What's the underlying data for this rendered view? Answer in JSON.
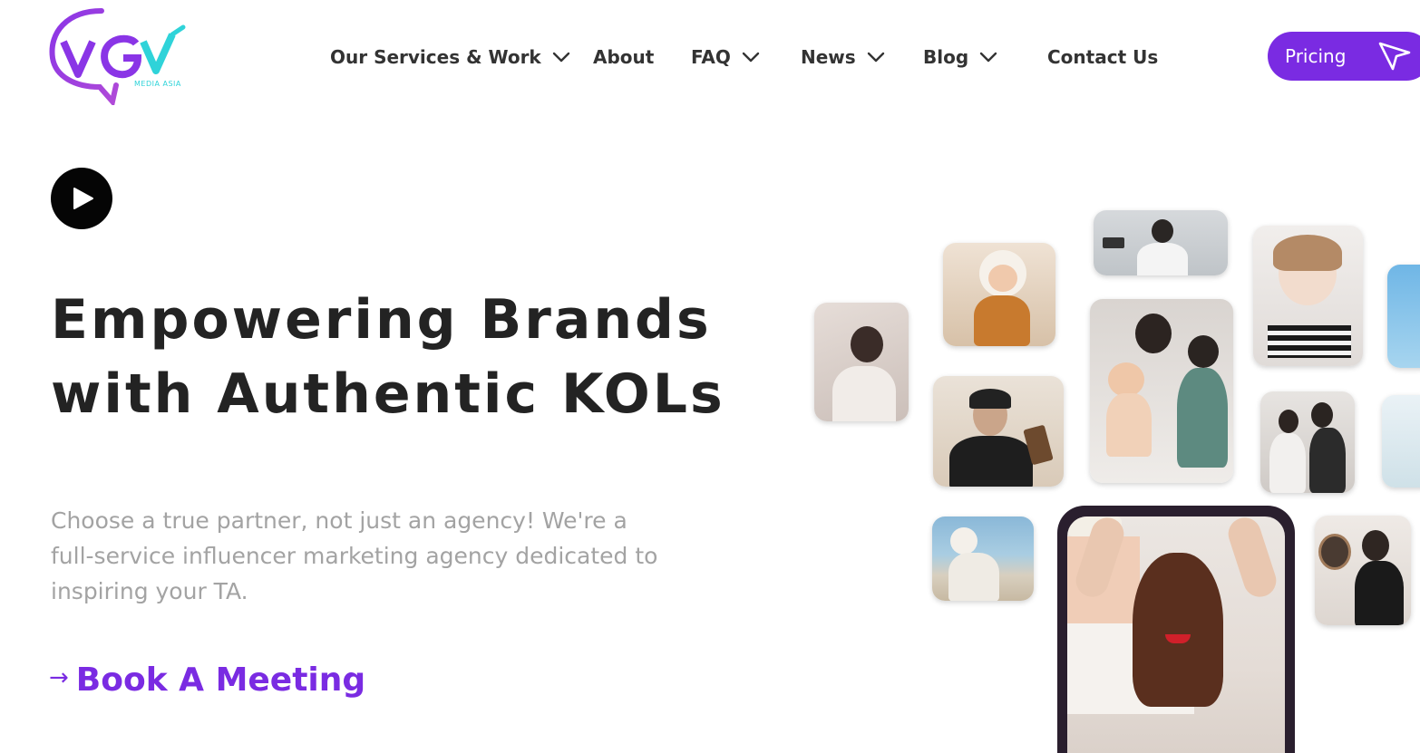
{
  "brand": {
    "logo_text": "VGV",
    "logo_subtext": "MEDIA ASIA",
    "colors": {
      "purple": "#7a2be2",
      "cyan": "#2fd3d9",
      "text_dark": "#232323",
      "text_muted": "#a3a3a3"
    }
  },
  "nav": {
    "items": [
      {
        "label": "Our Services & Work",
        "has_dropdown": true,
        "icon": "chevron-down-icon"
      },
      {
        "label": "About",
        "has_dropdown": false
      },
      {
        "label": "FAQ",
        "has_dropdown": true,
        "icon": "chevron-down-icon"
      },
      {
        "label": "News",
        "has_dropdown": true,
        "icon": "chevron-down-icon"
      },
      {
        "label": "Blog",
        "has_dropdown": true,
        "icon": "chevron-down-icon"
      },
      {
        "label": "Contact Us",
        "has_dropdown": false
      }
    ],
    "pricing_label": "Pricing",
    "pricing_icon": "paper-plane-icon"
  },
  "hero": {
    "play_icon": "play-icon",
    "headline_line1": "Empowering Brands",
    "headline_line2": "with Authentic KOLs",
    "description": "Choose a true partner, not just an agency! We're a full-service influencer marketing agency dedicated to inspiring your TA.",
    "cta_arrow": "→",
    "cta_label": "Book A Meeting"
  },
  "collage": {
    "photos": [
      "woman-lying-photo",
      "baby-costume-photo",
      "man-camera-photo",
      "woman-gift-box-photo",
      "man-snack-photo",
      "mother-children-photo",
      "couple-photo",
      "woman-beach-photo",
      "woman-mirror-photo",
      "phone-woman-photo"
    ]
  }
}
